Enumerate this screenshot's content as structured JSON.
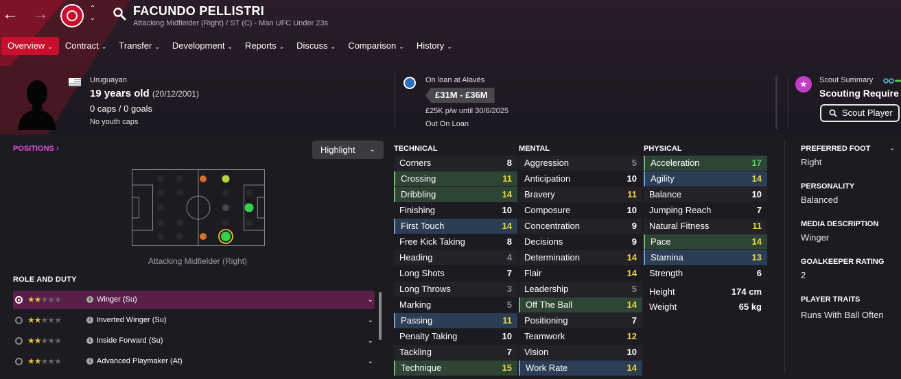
{
  "header": {
    "player_name": "FACUNDO PELLISTRI",
    "subtitle": "Attacking Midfielder (Right) / ST (C) - Man UFC Under 23s",
    "nationality": "Uruguayan",
    "age": "19 years old",
    "dob": "(20/12/2001)",
    "caps": "0 caps / 0 goals",
    "youth_caps": "No youth caps",
    "loan_status": "On loan at Alavés",
    "value": "£31M - £36M",
    "wage": "£25K p/w until 30/6/2025",
    "contract_status": "Out On Loan",
    "scout_summary_label": "Scout Summary",
    "scout_summary_value": "Scouting Require",
    "scout_button": "Scout Player"
  },
  "menu": [
    {
      "label": "Overview",
      "active": true
    },
    {
      "label": "Contract"
    },
    {
      "label": "Transfer"
    },
    {
      "label": "Development"
    },
    {
      "label": "Reports"
    },
    {
      "label": "Discuss"
    },
    {
      "label": "Comparison"
    },
    {
      "label": "History"
    }
  ],
  "positions": {
    "link": "POSITIONS",
    "highlight": "Highlight",
    "caption": "Attacking Midfielder (Right)"
  },
  "role_duty": {
    "title": "ROLE AND DUTY",
    "roles": [
      {
        "name": "Winger (Su)",
        "stars": 2
      },
      {
        "name": "Inverted Winger (Su)",
        "stars": 2
      },
      {
        "name": "Inside Forward (Su)",
        "stars": 2
      },
      {
        "name": "Advanced Playmaker (At)",
        "stars": 2
      }
    ]
  },
  "technical": {
    "title": "TECHNICAL",
    "attrs": [
      {
        "name": "Corners",
        "value": "8"
      },
      {
        "name": "Crossing",
        "value": "11",
        "hl": "green"
      },
      {
        "name": "Dribbling",
        "value": "14",
        "hl": "green"
      },
      {
        "name": "Finishing",
        "value": "10"
      },
      {
        "name": "First Touch",
        "value": "14",
        "hl": "blue"
      },
      {
        "name": "Free Kick Taking",
        "value": "8"
      },
      {
        "name": "Heading",
        "value": "4"
      },
      {
        "name": "Long Shots",
        "value": "7"
      },
      {
        "name": "Long Throws",
        "value": "3"
      },
      {
        "name": "Marking",
        "value": "5"
      },
      {
        "name": "Passing",
        "value": "11",
        "hl": "blue"
      },
      {
        "name": "Penalty Taking",
        "value": "10"
      },
      {
        "name": "Tackling",
        "value": "7"
      },
      {
        "name": "Technique",
        "value": "15",
        "hl": "green"
      }
    ]
  },
  "mental": {
    "title": "MENTAL",
    "attrs": [
      {
        "name": "Aggression",
        "value": "5"
      },
      {
        "name": "Anticipation",
        "value": "10"
      },
      {
        "name": "Bravery",
        "value": "11"
      },
      {
        "name": "Composure",
        "value": "10"
      },
      {
        "name": "Concentration",
        "value": "9"
      },
      {
        "name": "Decisions",
        "value": "9"
      },
      {
        "name": "Determination",
        "value": "14"
      },
      {
        "name": "Flair",
        "value": "14"
      },
      {
        "name": "Leadership",
        "value": "5"
      },
      {
        "name": "Off The Ball",
        "value": "14",
        "hl": "green"
      },
      {
        "name": "Positioning",
        "value": "7"
      },
      {
        "name": "Teamwork",
        "value": "12"
      },
      {
        "name": "Vision",
        "value": "10"
      },
      {
        "name": "Work Rate",
        "value": "14",
        "hl": "blue"
      }
    ]
  },
  "physical": {
    "title": "PHYSICAL",
    "attrs": [
      {
        "name": "Acceleration",
        "value": "17",
        "hl": "green"
      },
      {
        "name": "Agility",
        "value": "14",
        "hl": "blue"
      },
      {
        "name": "Balance",
        "value": "10"
      },
      {
        "name": "Jumping Reach",
        "value": "7"
      },
      {
        "name": "Natural Fitness",
        "value": "11"
      },
      {
        "name": "Pace",
        "value": "14",
        "hl": "green"
      },
      {
        "name": "Stamina",
        "value": "13",
        "hl": "blue"
      },
      {
        "name": "Strength",
        "value": "6"
      }
    ],
    "height_label": "Height",
    "height": "174 cm",
    "weight_label": "Weight",
    "weight": "65 kg"
  },
  "info": {
    "preferred_foot_label": "PREFERRED FOOT",
    "preferred_foot": "Right",
    "personality_label": "PERSONALITY",
    "personality": "Balanced",
    "media_label": "MEDIA DESCRIPTION",
    "media": "Winger",
    "gk_label": "GOALKEEPER RATING",
    "gk": "2",
    "traits_label": "PLAYER TRAITS",
    "traits": "Runs With Ball Often"
  },
  "icons": {
    "back": "arrow-left-icon",
    "forward": "arrow-right-icon",
    "search": "search-icon",
    "scout": "star-icon"
  },
  "colors": {
    "accent": "#c8102e",
    "positions_link": "#e04fd8",
    "value_top": "#54d257",
    "value_high": "#e6d742"
  }
}
